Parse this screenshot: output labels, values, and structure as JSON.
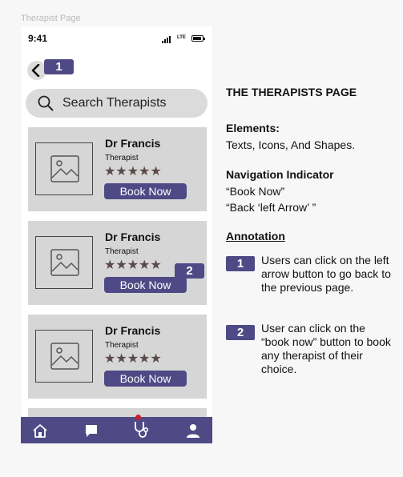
{
  "frame_label": "Therapist Page",
  "status_bar": {
    "time": "9:41",
    "network": "LTE"
  },
  "markers": {
    "one": "1",
    "two": "2"
  },
  "search": {
    "placeholder": "Search Therapists"
  },
  "therapists": [
    {
      "name": "Dr Francis",
      "role": "Therapist",
      "rating": 5,
      "button": "Book Now"
    },
    {
      "name": "Dr Francis",
      "role": "Therapist",
      "rating": 5,
      "button": "Book Now"
    },
    {
      "name": "Dr Francis",
      "role": "Therapist",
      "rating": 5,
      "button": "Book Now"
    }
  ],
  "bottom_nav": [
    "home-icon",
    "chat-icon",
    "stethoscope-icon",
    "profile-icon"
  ],
  "doc": {
    "title": "THE THERAPISTS PAGE",
    "elements_heading": "Elements:",
    "elements_text": "Texts, Icons, And Shapes.",
    "nav_heading": "Navigation Indicator",
    "nav_line1": "“Book Now”",
    "nav_line2": "“Back ‘left Arrow’ ”",
    "annotation_heading": "Annotation",
    "annotations": [
      {
        "num": "1",
        "text": "Users can click on the left arrow button to go back to the previous page."
      },
      {
        "num": "2",
        "text": "User can click on the “book now” button to book any therapist of their choice."
      }
    ]
  },
  "colors": {
    "accent": "#4f4a85",
    "card": "#d6d6d6",
    "search": "#dbdbdb",
    "alert": "#cc1f2a"
  }
}
